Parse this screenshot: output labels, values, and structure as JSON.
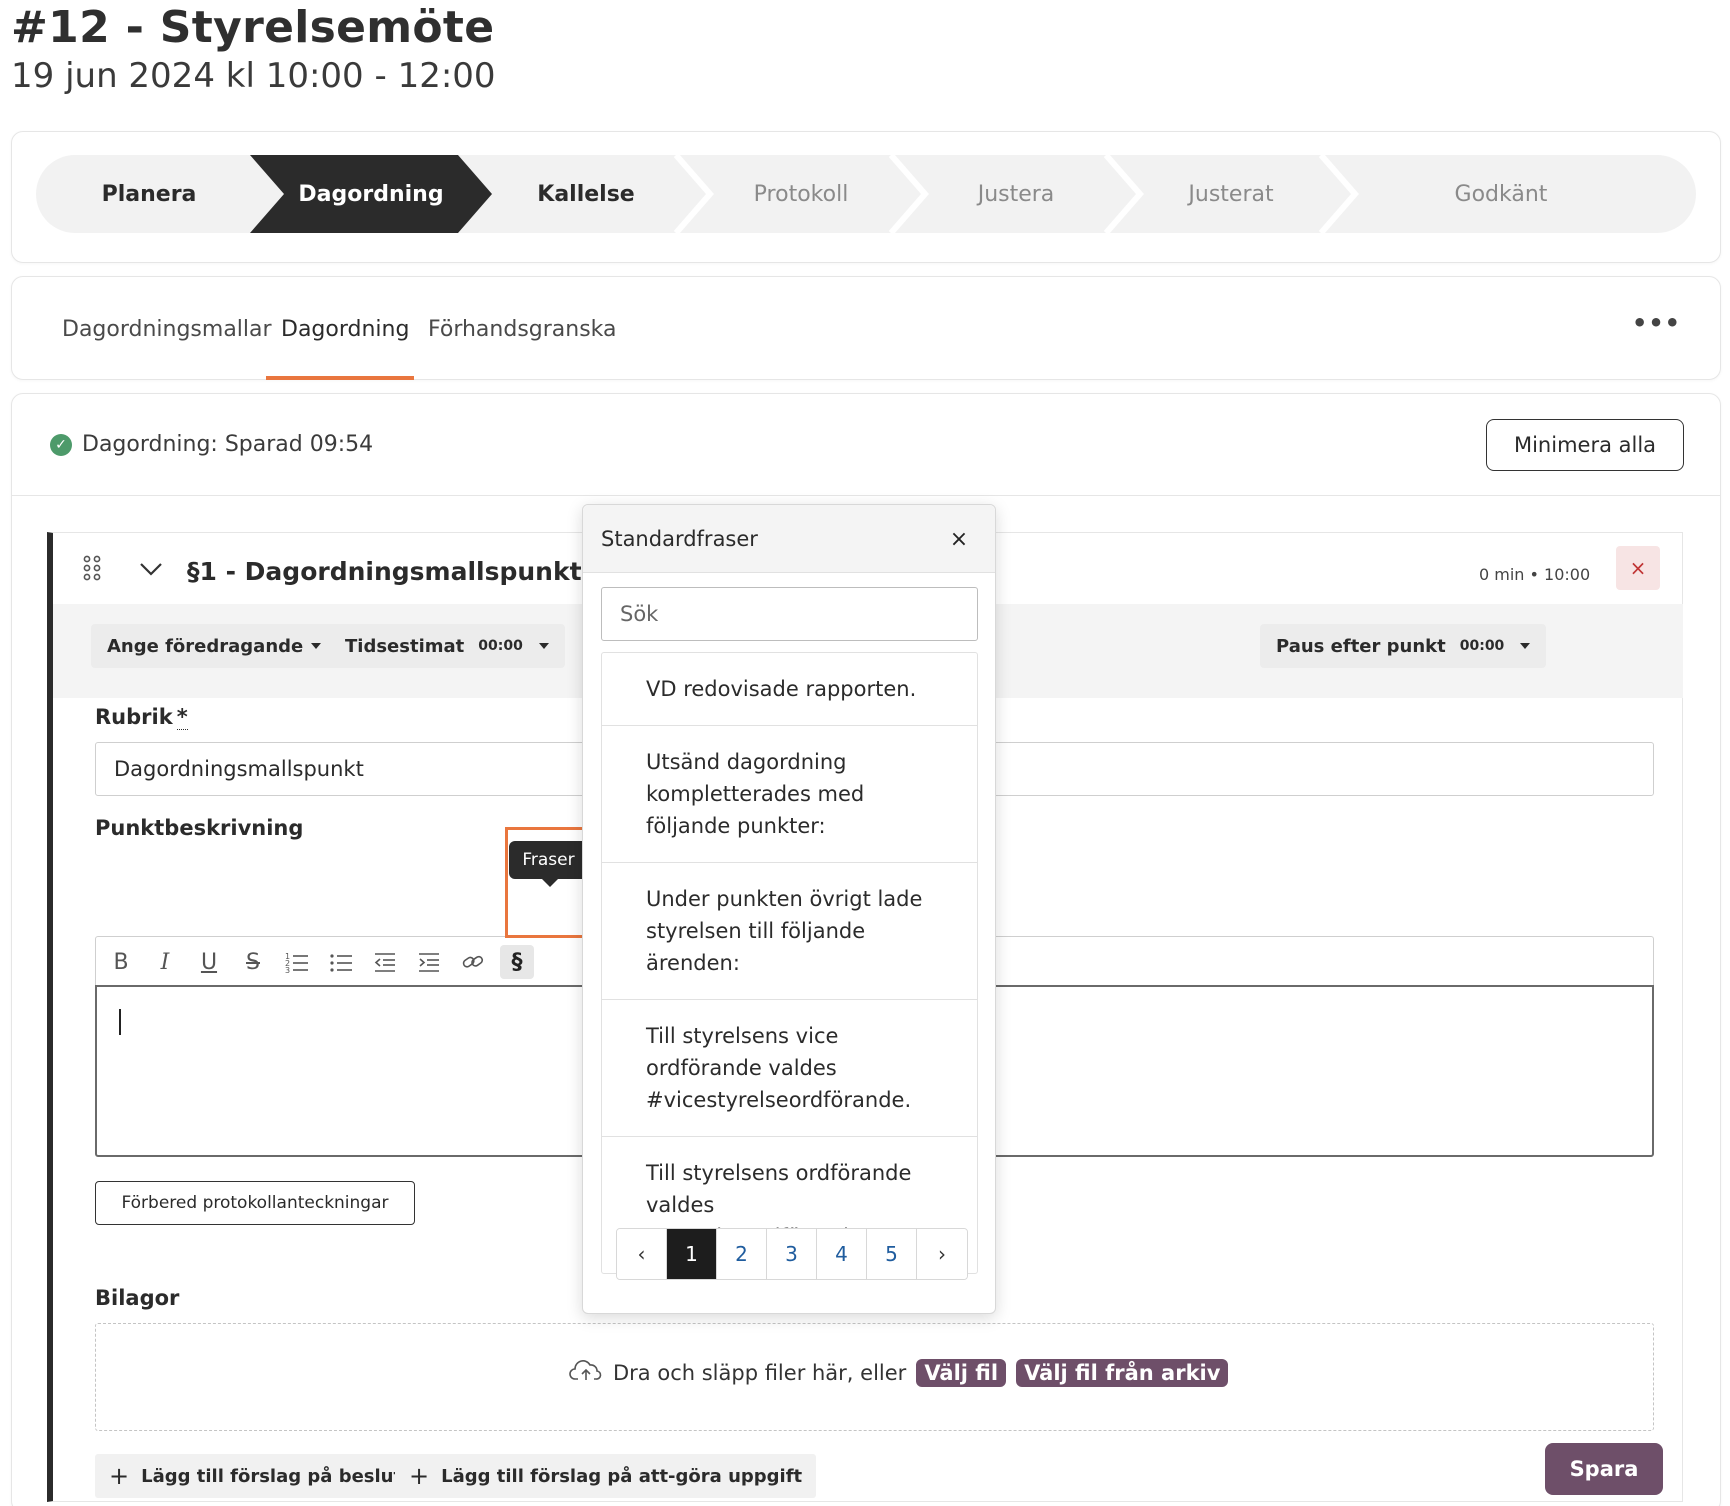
{
  "header": {
    "title": "#12 - Styrelsemöte",
    "subtitle": "19 jun 2024 kl 10:00 - 12:00"
  },
  "stepper": {
    "steps": [
      {
        "label": "Planera",
        "state": "done"
      },
      {
        "label": "Dagordning",
        "state": "active"
      },
      {
        "label": "Kallelse",
        "state": "done"
      },
      {
        "label": "Protokoll",
        "state": "pending"
      },
      {
        "label": "Justera",
        "state": "pending"
      },
      {
        "label": "Justerat",
        "state": "pending"
      },
      {
        "label": "Godkänt",
        "state": "pending"
      }
    ]
  },
  "tabs": {
    "items": [
      "Dagordningsmallar",
      "Dagordning",
      "Förhandsgranska"
    ],
    "active": "Dagordning",
    "more": "•••"
  },
  "status": {
    "text": "Dagordning: Sparad 09:54",
    "minimize_label": "Minimera alla"
  },
  "item": {
    "title": "§1 - Dagordningsmallspunkt",
    "meta": "0 min • 10:00",
    "delete_icon": "×",
    "presenter_label": "Ange föredragande",
    "time_estimate_label": "Tidsestimat",
    "time_estimate_value": "00:00",
    "pause_label": "Paus efter punkt",
    "pause_value": "00:00",
    "rubrik_label": "Rubrik",
    "required_mark": "*",
    "rubrik_value": "Dagordningsmallspunkt",
    "description_label": "Punktbeskrivning",
    "prepare_label": "Förbered protokollanteckningar",
    "attachments_label": "Bilagor",
    "dropzone_text": "Dra och släpp filer här, eller",
    "choose_file": "Välj fil",
    "choose_archive": "Välj fil från arkiv",
    "add_decision": "Lägg till förslag på beslut",
    "add_todo": "Lägg till förslag på att-göra uppgift",
    "save_label": "Spara"
  },
  "editor_toolbar": {
    "tools": [
      {
        "icon": "bold-icon",
        "glyph": "B"
      },
      {
        "icon": "italic-icon",
        "glyph": "I"
      },
      {
        "icon": "underline-icon",
        "glyph": "U"
      },
      {
        "icon": "strikethrough-icon",
        "glyph": "S"
      },
      {
        "icon": "ordered-list-icon",
        "glyph": "1≡"
      },
      {
        "icon": "bullet-list-icon",
        "glyph": "•≡"
      },
      {
        "icon": "outdent-icon",
        "glyph": "⇤"
      },
      {
        "icon": "indent-icon",
        "glyph": "⇥"
      },
      {
        "icon": "link-icon",
        "glyph": "🔗"
      },
      {
        "icon": "phrases-icon",
        "glyph": "§"
      }
    ],
    "tooltip": "Fraser"
  },
  "popover": {
    "title": "Standardfraser",
    "close_icon": "×",
    "search_placeholder": "Sök",
    "phrases": [
      "VD redovisade rapporten.",
      "Utsänd dagordning kompletterades med följande punkter:",
      "Under punkten övrigt lade styrelsen till följande ärenden:",
      "Till styrelsens vice ordförande valdes #vicestyrelseordförande.",
      "Till styrelsens ordförande valdes #styrelseordförande."
    ],
    "pages": [
      "1",
      "2",
      "3",
      "4",
      "5"
    ],
    "active_page": "1",
    "prev_icon": "‹",
    "next_icon": "›"
  },
  "colors": {
    "accent": "#e9763e",
    "primary": "#6e4f69",
    "success": "#4d9a6a",
    "dark": "#2b2b2b"
  }
}
